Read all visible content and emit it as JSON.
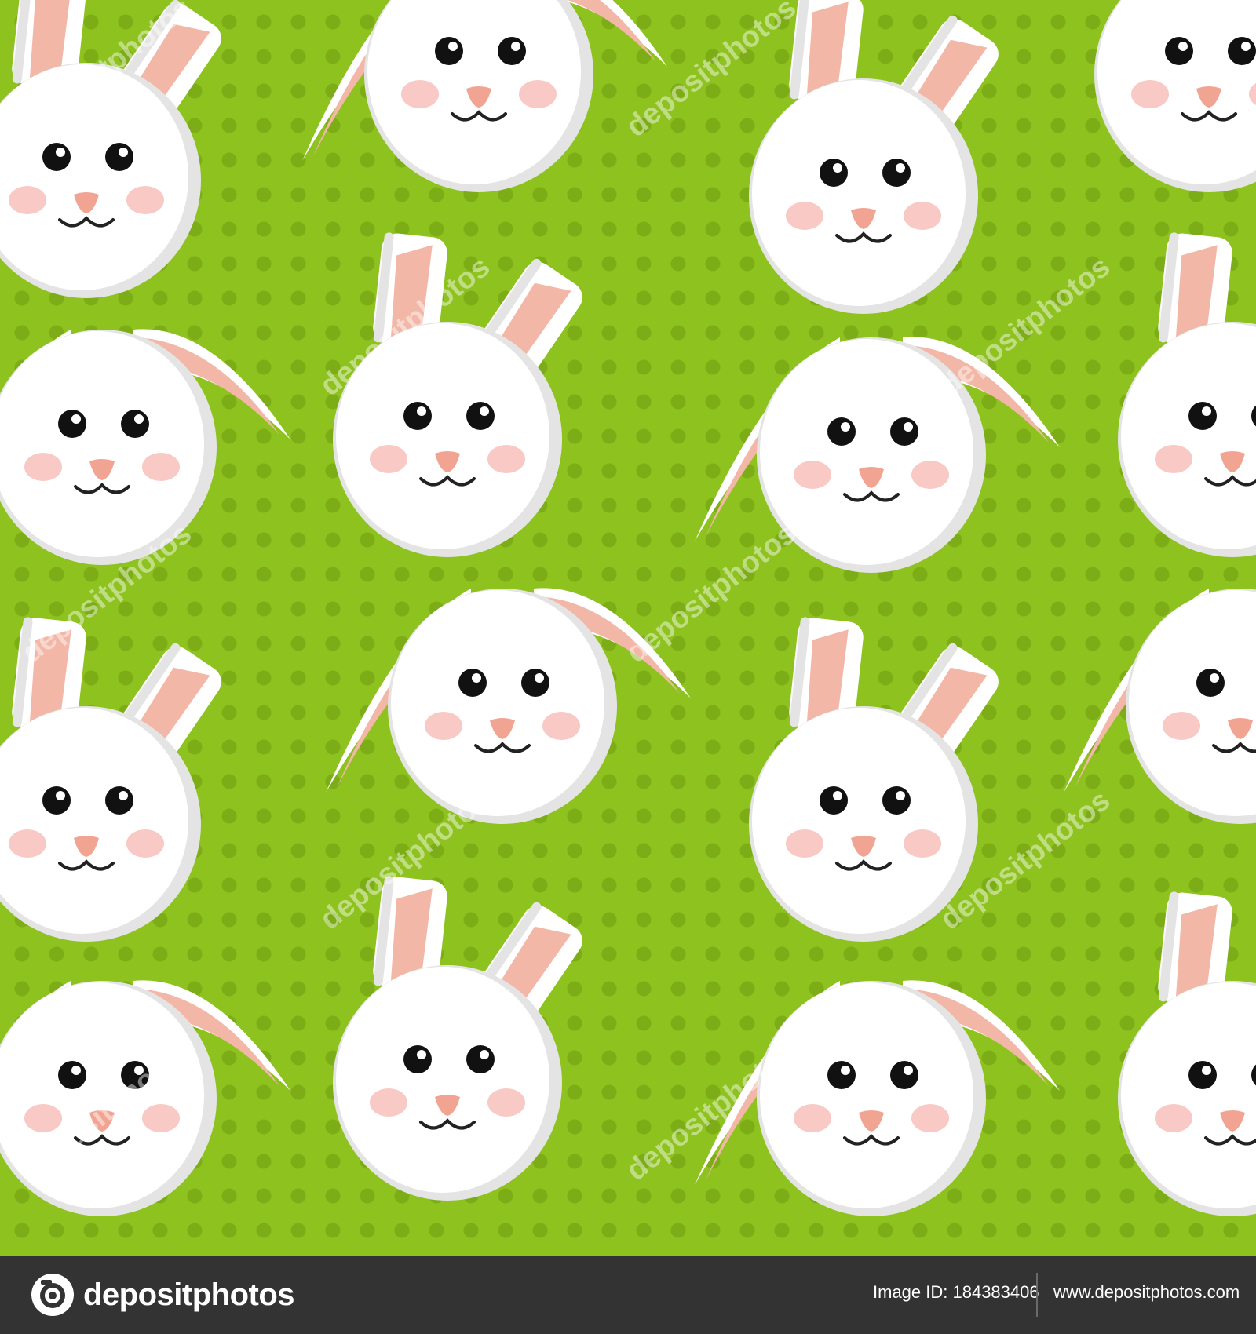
{
  "artwork": {
    "description_kind": "seamless rabbit pattern",
    "background_color": "#8dc21f",
    "dot_color": "#7cad17",
    "face_color": "#ffffff",
    "shade_color": "#e4e4e4",
    "ear_inner_color": "#f3b7a7",
    "cheek_color": "#f8c9c5",
    "nose_color": "#f2a493",
    "watermark_text": "depositphotos"
  },
  "footer": {
    "logo_text": "depositphotos",
    "image_id": "Image ID: 184383406",
    "site_url": "www.depositphotos.com"
  }
}
